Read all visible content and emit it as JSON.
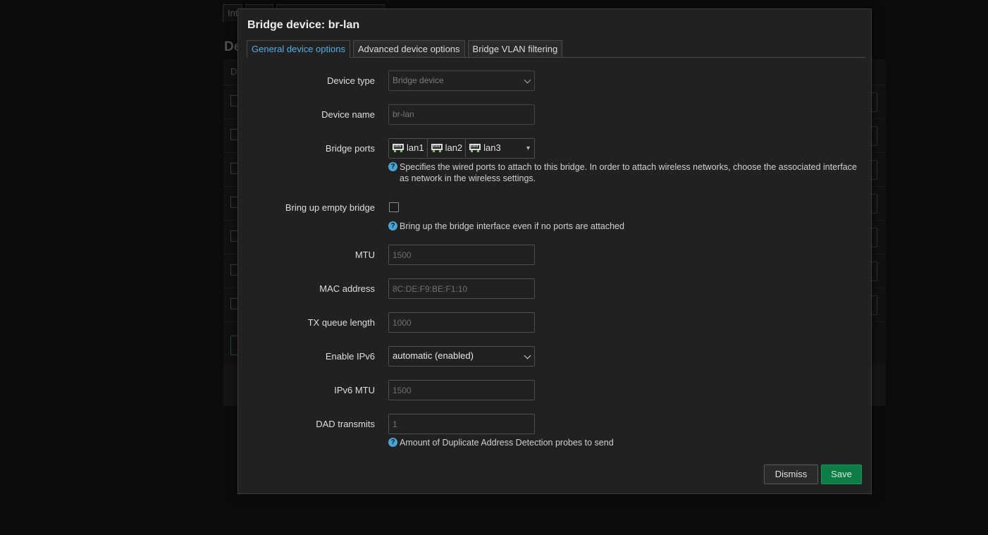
{
  "background": {
    "tab_labels": [
      "Int",
      "",
      ""
    ],
    "heading": "De",
    "table_header": "D"
  },
  "modal": {
    "title": "Bridge device: br-lan",
    "tabs": [
      {
        "label": "General device options",
        "active": true
      },
      {
        "label": "Advanced device options",
        "active": false
      },
      {
        "label": "Bridge VLAN filtering",
        "active": false
      }
    ],
    "fields": {
      "device_type": {
        "label": "Device type",
        "value": "Bridge device"
      },
      "device_name": {
        "label": "Device name",
        "value": "br-lan"
      },
      "bridge_ports": {
        "label": "Bridge ports",
        "ports": [
          "lan1",
          "lan2",
          "lan3"
        ],
        "dropdown_arrow": "▾",
        "hint": "Specifies the wired ports to attach to this bridge. In order to attach wireless networks, choose the associated interface as network in the wireless settings."
      },
      "bring_up_empty": {
        "label": "Bring up empty bridge",
        "checked": false,
        "hint": "Bring up the bridge interface even if no ports are attached"
      },
      "mtu": {
        "label": "MTU",
        "placeholder": "1500"
      },
      "mac_address": {
        "label": "MAC address",
        "placeholder": "8C:DE:F9:BE:F1:10"
      },
      "tx_queue_length": {
        "label": "TX queue length",
        "placeholder": "1000"
      },
      "enable_ipv6": {
        "label": "Enable IPv6",
        "value": "automatic (enabled)"
      },
      "ipv6_mtu": {
        "label": "IPv6 MTU",
        "placeholder": "1500"
      },
      "dad_transmits": {
        "label": "DAD transmits",
        "placeholder": "1",
        "hint": "Amount of Duplicate Address Detection probes to send"
      }
    },
    "help_icon_glyph": "?",
    "buttons": {
      "dismiss": "Dismiss",
      "save": "Save"
    }
  },
  "colors": {
    "accent_tab": "#55aee6",
    "save_button": "#0c7b46",
    "help_icon": "#4aa3d6"
  },
  "icons": {
    "port": "ethernet-port-icon",
    "help": "help-circle-icon",
    "dropdown": "chevron-down-icon"
  }
}
